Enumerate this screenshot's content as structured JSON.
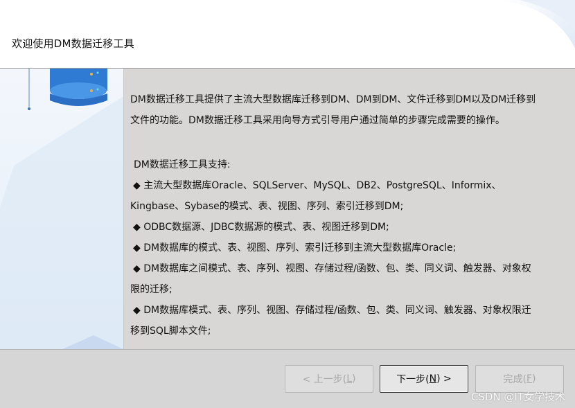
{
  "header": {
    "title": "欢迎使用DM数据迁移工具"
  },
  "intro": {
    "line1": "DM数据迁移工具提供了主流大型数据库迁移到DM、DM到DM、文件迁移到DM以及DM迁移到",
    "line2": "文件的功能。DM数据迁移工具采用向导方式引导用户通过简单的步骤完成需要的操作。"
  },
  "features": {
    "title": "DM数据迁移工具支持:",
    "lines": [
      "◆ 主流大型数据库Oracle、SQLServer、MySQL、DB2、PostgreSQL、Informix、",
      "Kingbase、Sybase的模式、表、视图、序列、索引迁移到DM;",
      "◆ ODBC数据源、JDBC数据源的模式、表、视图迁移到DM;",
      "◆ DM数据库的模式、表、视图、序列、索引迁移到主流大型数据库Oracle;",
      "◆ DM数据库之间模式、表、序列、视图、存储过程/函数、包、类、同义词、触发器、对象权",
      "限的迁移;",
      "◆ DM数据库模式、表、序列、视图、存储过程/函数、包、类、同义词、触发器、对象权限迁",
      "移到SQL脚本文件;"
    ]
  },
  "buttons": {
    "back": {
      "text": "< 上一步(",
      "key": "L",
      "end": ")"
    },
    "next": {
      "text": "下一步(",
      "key": "N",
      "end": ") >"
    },
    "finish": {
      "text": "完成(",
      "key": "F",
      "end": ")"
    }
  },
  "watermark": "CSDN @IT女学技术",
  "colors": {
    "content_bg": "#d8d7d5",
    "left_panel_bg": "#e8f0f9",
    "database_blue": "#3d8ee0"
  },
  "icons": {
    "database": "database-icon"
  }
}
